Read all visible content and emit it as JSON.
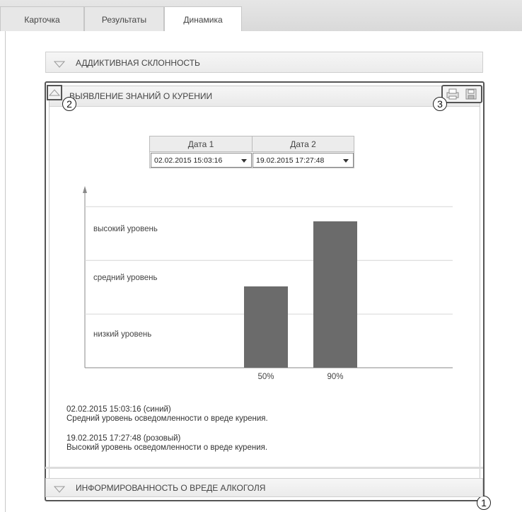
{
  "tabs": [
    {
      "label": "Карточка"
    },
    {
      "label": "Результаты"
    },
    {
      "label": "Динамика",
      "active": true
    }
  ],
  "sections": {
    "addictive": {
      "title": "АДДИКТИВНАЯ СКЛОННОСТЬ",
      "expanded": false
    },
    "smoking": {
      "title": "ВЫЯВЛЕНИЕ ЗНАНИЙ О КУРЕНИИ",
      "expanded": true
    },
    "alcohol": {
      "title": "ИНФОРМИРОВАННОСТЬ О ВРЕДЕ АЛКОГОЛЯ",
      "expanded": false
    }
  },
  "toolbar": {
    "print_icon": "print-icon",
    "save_icon": "save-icon"
  },
  "callouts": {
    "one": "1",
    "two": "2",
    "three": "3"
  },
  "dates": {
    "col1_header": "Дата 1",
    "col2_header": "Дата 2",
    "col1_value": "02.02.2015 15:03:16",
    "col2_value": "19.02.2015 17:27:48"
  },
  "chart_data": {
    "type": "bar",
    "categories": [
      "50%",
      "90%"
    ],
    "values": [
      50,
      90
    ],
    "y_levels": [
      "низкий уровень",
      "средний уровень",
      "высокий уровень"
    ],
    "ylim": [
      0,
      100
    ],
    "colors": {
      "bar": "#6b6b6b",
      "grid": "#d6d6d6",
      "axis": "#8a8a8a"
    }
  },
  "results": [
    {
      "line1": "02.02.2015 15:03:16 (синий)",
      "line2": "Средний уровень осведомленности о вреде курения."
    },
    {
      "line1": "19.02.2015 17:27:48 (розовый)",
      "line2": "Высокий уровень осведомленности о вреде курения."
    }
  ]
}
